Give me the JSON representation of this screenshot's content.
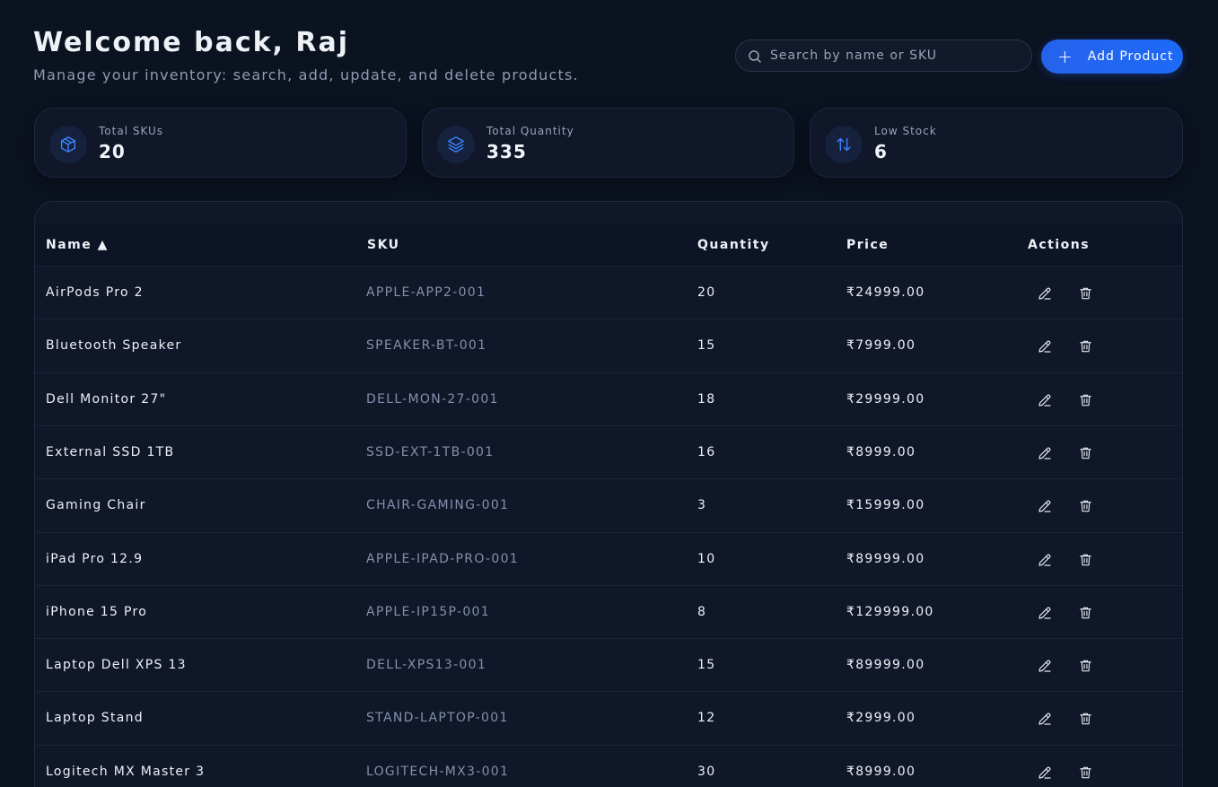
{
  "header": {
    "title": "Welcome back, Raj",
    "subtitle": "Manage your inventory: search, add, update, and delete products."
  },
  "search": {
    "placeholder": "Search by name or SKU",
    "value": ""
  },
  "add_button": {
    "label": "Add Product"
  },
  "stats": [
    {
      "label": "Total SKUs",
      "value": "20",
      "icon": "box-icon"
    },
    {
      "label": "Total Quantity",
      "value": "335",
      "icon": "layers-icon"
    },
    {
      "label": "Low Stock",
      "value": "6",
      "icon": "sort-arrows-icon"
    }
  ],
  "table": {
    "columns": [
      "Name ▲",
      "SKU",
      "Quantity",
      "Price",
      "Actions"
    ],
    "rows": [
      {
        "name": "AirPods Pro 2",
        "sku": "APPLE-APP2-001",
        "quantity": "20",
        "price": "₹24999.00"
      },
      {
        "name": "Bluetooth Speaker",
        "sku": "SPEAKER-BT-001",
        "quantity": "15",
        "price": "₹7999.00"
      },
      {
        "name": "Dell Monitor 27\"",
        "sku": "DELL-MON-27-001",
        "quantity": "18",
        "price": "₹29999.00"
      },
      {
        "name": "External SSD 1TB",
        "sku": "SSD-EXT-1TB-001",
        "quantity": "16",
        "price": "₹8999.00"
      },
      {
        "name": "Gaming Chair",
        "sku": "CHAIR-GAMING-001",
        "quantity": "3",
        "price": "₹15999.00"
      },
      {
        "name": "iPad Pro 12.9",
        "sku": "APPLE-IPAD-PRO-001",
        "quantity": "10",
        "price": "₹89999.00"
      },
      {
        "name": "iPhone 15 Pro",
        "sku": "APPLE-IP15P-001",
        "quantity": "8",
        "price": "₹129999.00"
      },
      {
        "name": "Laptop Dell XPS 13",
        "sku": "DELL-XPS13-001",
        "quantity": "15",
        "price": "₹89999.00"
      },
      {
        "name": "Laptop Stand",
        "sku": "STAND-LAPTOP-001",
        "quantity": "12",
        "price": "₹2999.00"
      },
      {
        "name": "Logitech MX Master 3",
        "sku": "LOGITECH-MX3-001",
        "quantity": "30",
        "price": "₹8999.00"
      }
    ]
  },
  "colors": {
    "accent": "#2563eb",
    "background": "#0b1220",
    "card": "#0f1729"
  }
}
